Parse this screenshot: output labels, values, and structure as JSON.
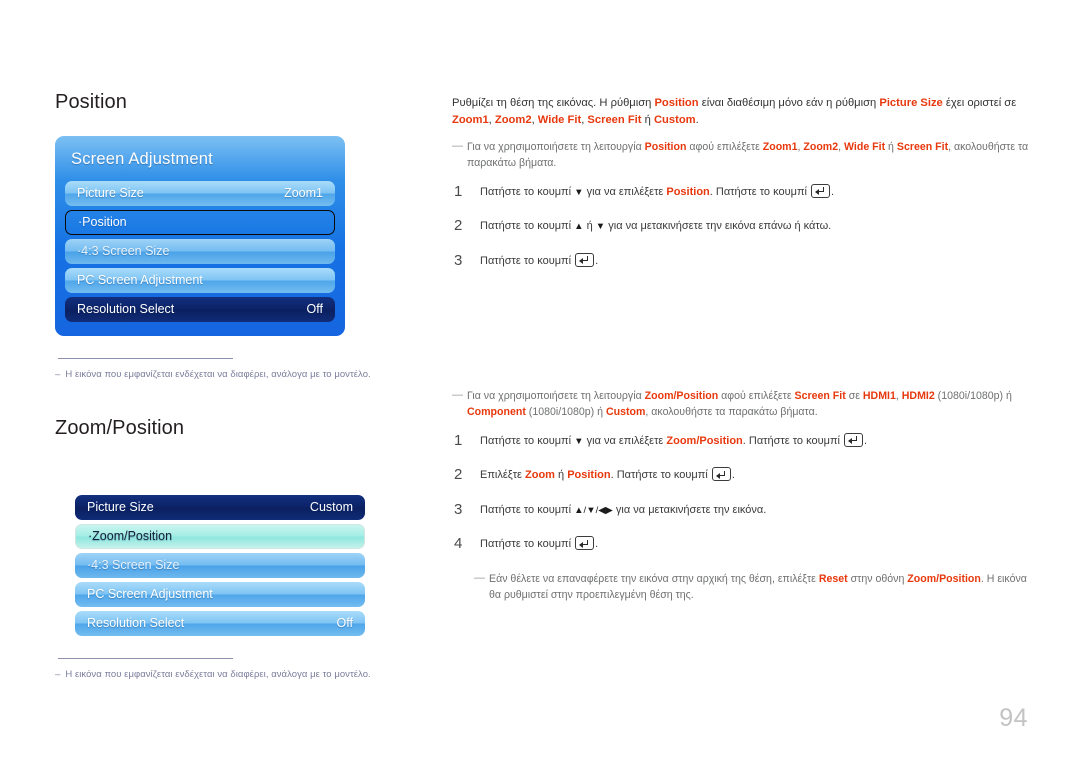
{
  "page": {
    "number": "94"
  },
  "sections": [
    {
      "title": "Position",
      "osd": {
        "has_container": true,
        "title": "Screen Adjustment",
        "rows": [
          {
            "label": "Picture Size",
            "value": "Zoom1",
            "style": "light"
          },
          {
            "label": "·Position",
            "value": "",
            "style": "selected-outline"
          },
          {
            "label": "·4:3 Screen Size",
            "value": "",
            "style": "lightdim"
          },
          {
            "label": "PC Screen Adjustment",
            "value": "",
            "style": "light"
          },
          {
            "label": "Resolution Select",
            "value": "Off",
            "style": "dark"
          }
        ]
      },
      "footnote": {
        "dash": "–",
        "text": "Η εικόνα που εμφανίζεται ενδέχεται να διαφέρει, ανάλογα με το μοντέλο."
      }
    },
    {
      "title": "Zoom/Position",
      "osd": {
        "has_container": false,
        "title": "",
        "rows": [
          {
            "label": "Picture Size",
            "value": "Custom",
            "style": "dark"
          },
          {
            "label": "·Zoom/Position",
            "value": "",
            "style": "cyan"
          },
          {
            "label": "·4:3 Screen Size",
            "value": "",
            "style": "lightdim"
          },
          {
            "label": "PC Screen Adjustment",
            "value": "",
            "style": "light"
          },
          {
            "label": "Resolution Select",
            "value": "Off",
            "style": "light"
          }
        ]
      },
      "footnote": {
        "dash": "–",
        "text": "Η εικόνα που εμφανίζεται ενδέχεται να διαφέρει, ανάλογα με το μοντέλο."
      }
    }
  ],
  "right": {
    "position_block": {
      "intro": {
        "t1": "Ρυθμίζει τη θέση της εικόνας. Η ρύθμιση ",
        "k1": "Position",
        "t2": " είναι διαθέσιμη μόνο εάν η ρύθμιση ",
        "k2": "Picture Size",
        "t3": " έχει οριστεί σε ",
        "k3": "Zoom1",
        "sep1": ", ",
        "k4": "Zoom2",
        "sep2": ", ",
        "k5": "Wide Fit",
        "sep3": ", ",
        "k6": "Screen Fit",
        "t4": " ή ",
        "k7": "Custom",
        "t5": "."
      },
      "tip": {
        "t1": "Για να χρησιμοποιήσετε τη λειτουργία ",
        "k1": "Position",
        "t2": " αφού επιλέξετε ",
        "k2": "Zoom1",
        "sep1": ", ",
        "k3": "Zoom2",
        "sep2": ", ",
        "k4": "Wide Fit",
        "t3": " ή ",
        "k5": "Screen Fit",
        "t4": ", ακολουθήστε τα παρακάτω βήματα."
      },
      "steps": [
        {
          "num": "1",
          "t1": "Πατήστε το κουμπί ",
          "arrow": "▼",
          "t2": " για να επιλέξετε ",
          "k1": "Position",
          "t3": ". Πατήστε το κουμπί ",
          "t4": "."
        },
        {
          "num": "2",
          "t1": "Πατήστε το κουμπί ",
          "arrow": "▲",
          "t2": " ή ",
          "arrow2": "▼",
          "t3": " για να μετακινήσετε την εικόνα επάνω ή κάτω."
        },
        {
          "num": "3",
          "t1": "Πατήστε το κουμπί ",
          "t4": "."
        }
      ]
    },
    "zoom_block": {
      "tip": {
        "t1": "Για να χρησιμοποιήσετε τη λειτουργία ",
        "k1": "Zoom/Position",
        "t2": " αφού επιλέξετε ",
        "k2": "Screen Fit",
        "t3": " σε ",
        "k3": "HDMI1",
        "sep1": ", ",
        "k4": "HDMI2",
        "t4": " (1080i/1080p) ή ",
        "k5": "Component",
        "t5": " (1080i/1080p) ή ",
        "k6": "Custom",
        "t6": ", ακολουθήστε τα παρακάτω βήματα."
      },
      "steps": [
        {
          "num": "1",
          "t1": "Πατήστε το κουμπί ",
          "arrow": "▼",
          "t2": " για να επιλέξετε ",
          "k1": "Zoom/Position",
          "t3": ". Πατήστε το κουμπί ",
          "t4": "."
        },
        {
          "num": "2",
          "t1": "Επιλέξτε ",
          "k1": "Zoom",
          "t2": " ή ",
          "k2": "Position",
          "t3": ". Πατήστε το κουμπί ",
          "t4": "."
        },
        {
          "num": "3",
          "t1": "Πατήστε το κουμπί ",
          "arrow": "▲/▼/◀▶",
          "t2": " για να μετακινήσετε την εικόνα."
        },
        {
          "num": "4",
          "t1": "Πατήστε το κουμπί ",
          "t4": "."
        }
      ],
      "tip2": {
        "t1": "Εάν θέλετε να επαναφέρετε την εικόνα στην αρχική της θέση, επιλέξτε ",
        "k1": "Reset",
        "t2": " στην οθόνη ",
        "k2": "Zoom/Position",
        "t3": ". Η εικόνα θα ρυθμιστεί στην προεπιλεγμένη θέση της."
      }
    }
  },
  "colors": {
    "keyword": "#e8380d",
    "osd_panel_blue": "#1673e4",
    "osd_row_dark": "#0c2266",
    "osd_row_cyan": "#a6eee6",
    "footnote": "#7b7d9c",
    "page_number": "#c3c3c3"
  }
}
